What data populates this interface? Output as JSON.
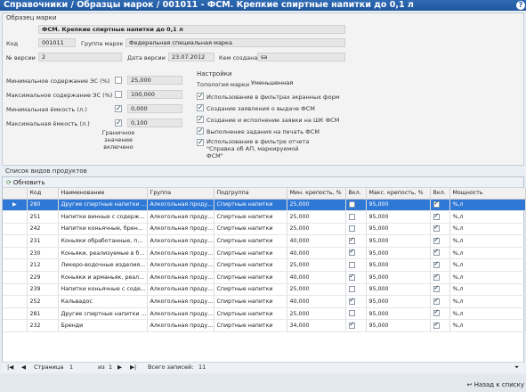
{
  "header": {
    "title": "Справочники / Образцы марок / 001011 - ФСМ. Крепкие спиртные напитки до 0,1 л"
  },
  "sample": {
    "section": "Образец марки",
    "name": "ФСМ. Крепкие спиртные напитки до 0,1 л",
    "code_label": "Код",
    "code": "001011",
    "group_label": "Группа марок",
    "group": "Федеральная специальная марка",
    "version_label": "№ версии",
    "version": "2",
    "date_label": "Дата версии",
    "date": "23.07.2012",
    "creator_label": "Кем создана",
    "creator": "sa"
  },
  "limits": {
    "min_es_label": "Минимальное содержание ЭС (%)",
    "min_es": "25,000",
    "max_es_label": "Максимальное содержание ЭС (%)",
    "max_es": "100,000",
    "min_cap_label": "Минимальная ёмкость  (л.)",
    "min_cap": "0,000",
    "max_cap_label": "Максимальная ёмкость (л.)",
    "max_cap": "0,100",
    "boundary_note": "Граничное значение включено"
  },
  "settings": {
    "section": "Настройки",
    "topology_label": "Топология марки",
    "topology": "Уменьшенная",
    "options": [
      "Использование в фильтрах экранных форм",
      "Создание заявления о выдаче ФСМ",
      "Создание и исполнение заявки на ШК ФСМ",
      "Выполнение задания на печать ФСМ",
      "Использование в фильтре отчета \"Справка об АП, маркируемой ФСМ\""
    ]
  },
  "products": {
    "section": "Список видов продуктов",
    "refresh": "Обновить",
    "columns": [
      "Код",
      "Наименование",
      "Группа",
      "Подгруппа",
      "Мин. крепость, %",
      "Вкл.",
      "Макс. крепость, %",
      "Вкл.",
      "Мощность"
    ],
    "rows": [
      {
        "code": "280",
        "name": "Другие спиртные напитки ...",
        "group": "Алкогольная проду...",
        "sub": "Спиртные напитки",
        "min": "25,000",
        "min_on": false,
        "max": "95,000",
        "max_on": true,
        "power": "%,л"
      },
      {
        "code": "251",
        "name": "Напитки винные с содерж...",
        "group": "Алкогольная проду...",
        "sub": "Спиртные напитки",
        "min": "25,000",
        "min_on": false,
        "max": "95,000",
        "max_on": true,
        "power": "%,л"
      },
      {
        "code": "242",
        "name": "Напитки коньячные, брен...",
        "group": "Алкогольная проду...",
        "sub": "Спиртные напитки",
        "min": "25,000",
        "min_on": false,
        "max": "95,000",
        "max_on": true,
        "power": "%,л"
      },
      {
        "code": "231",
        "name": "Коньяки обработанные, п...",
        "group": "Алкогольная проду...",
        "sub": "Спиртные напитки",
        "min": "40,000",
        "min_on": true,
        "max": "95,000",
        "max_on": true,
        "power": "%,л"
      },
      {
        "code": "230",
        "name": "Коньяки, реализуемые в б...",
        "group": "Алкогольная проду...",
        "sub": "Спиртные напитки",
        "min": "40,000",
        "min_on": true,
        "max": "95,000",
        "max_on": true,
        "power": "%,л"
      },
      {
        "code": "212",
        "name": "Ликеро-водочные изделия...",
        "group": "Алкогольная проду...",
        "sub": "Спиртные напитки",
        "min": "25,000",
        "min_on": false,
        "max": "95,000",
        "max_on": true,
        "power": "%,л"
      },
      {
        "code": "229",
        "name": "Коньяки и арманьяк, реал...",
        "group": "Алкогольная проду...",
        "sub": "Спиртные напитки",
        "min": "40,000",
        "min_on": true,
        "max": "95,000",
        "max_on": true,
        "power": "%,л"
      },
      {
        "code": "239",
        "name": "Напитки коньячные с соде...",
        "group": "Алкогольная проду...",
        "sub": "Спиртные напитки",
        "min": "25,000",
        "min_on": false,
        "max": "95,000",
        "max_on": true,
        "power": "%,л"
      },
      {
        "code": "252",
        "name": "Кальвадос",
        "group": "Алкогольная проду...",
        "sub": "Спиртные напитки",
        "min": "40,000",
        "min_on": true,
        "max": "95,000",
        "max_on": true,
        "power": "%,л"
      },
      {
        "code": "281",
        "name": "Другие спиртные напитки ...",
        "group": "Алкогольная проду...",
        "sub": "Спиртные напитки",
        "min": "25,000",
        "min_on": false,
        "max": "95,000",
        "max_on": true,
        "power": "%,л"
      },
      {
        "code": "232",
        "name": "Бренди",
        "group": "Алкогольная проду...",
        "sub": "Спиртные напитки",
        "min": "34,000",
        "min_on": true,
        "max": "95,000",
        "max_on": true,
        "power": "%,л"
      }
    ]
  },
  "pager": {
    "page_label": "Страница",
    "page": "1",
    "of_label": "из",
    "of": "1",
    "total_label": "Всего записей:",
    "total": "11"
  },
  "footer": {
    "back": "Назад к списку"
  }
}
